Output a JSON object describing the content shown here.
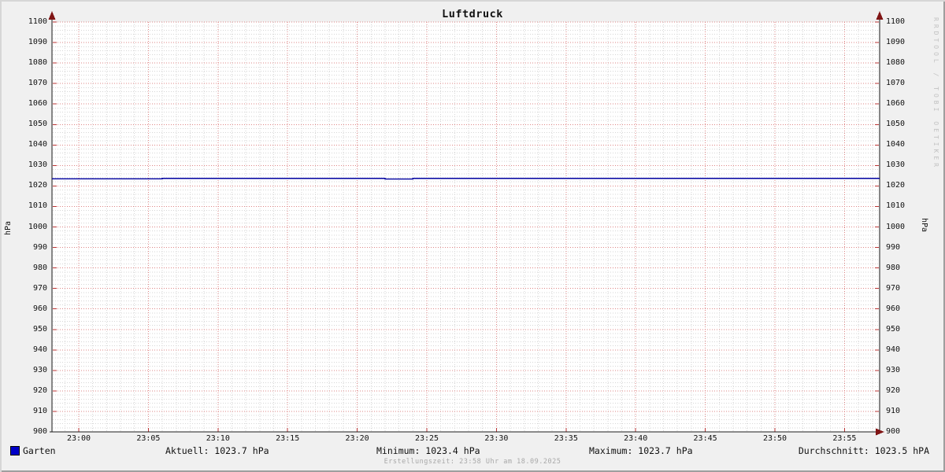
{
  "graph": {
    "title": "Luftdruck",
    "watermark": "RRDTOOL / TOBI OETIKER",
    "footer": "Erstellungszeit: 23:58 Uhr am 18.09.2025",
    "y_unit_left": "hPa",
    "y_unit_right": "hPa"
  },
  "legend": {
    "series_label": "Garten",
    "series_swatch_color": "#0000c8",
    "aktuell": "Aktuell: 1023.7 hPa",
    "minimum": "Minimum: 1023.4 hPa",
    "maximum": "Maximum: 1023.7 hPa",
    "durchschnitt": "Durchschnitt: 1023.5 hPA"
  },
  "chart_data": {
    "type": "line",
    "title": "Luftdruck",
    "xlabel": "",
    "ylabel": "hPa",
    "ylim": [
      900,
      1100
    ],
    "y_major_step": 10,
    "y_minor_step": 2,
    "x_ticks": [
      "23:00",
      "23:05",
      "23:10",
      "23:15",
      "23:20",
      "23:25",
      "23:30",
      "23:35",
      "23:40",
      "23:45",
      "23:50",
      "23:55"
    ],
    "x_minor_per_major": 5,
    "grid": true,
    "legend_position": "bottom",
    "series": [
      {
        "name": "Garten",
        "color": "#0000a0",
        "x_unit": "minutes after 23:00",
        "step_points": [
          [
            0,
            1023.5
          ],
          [
            6,
            1023.7
          ],
          [
            22,
            1023.4
          ],
          [
            24,
            1023.7
          ],
          [
            58,
            1023.7
          ]
        ]
      }
    ],
    "stats": {
      "current": 1023.7,
      "min": 1023.4,
      "max": 1023.7,
      "avg": 1023.5
    },
    "colors": {
      "background": "#f0f0f0",
      "canvas": "#ffffff",
      "major_grid": "#de8585",
      "minor_grid": "#d6d6d6",
      "axis": "#1c1c1c",
      "tick": "#bb3333",
      "arrow": "#801515"
    }
  }
}
